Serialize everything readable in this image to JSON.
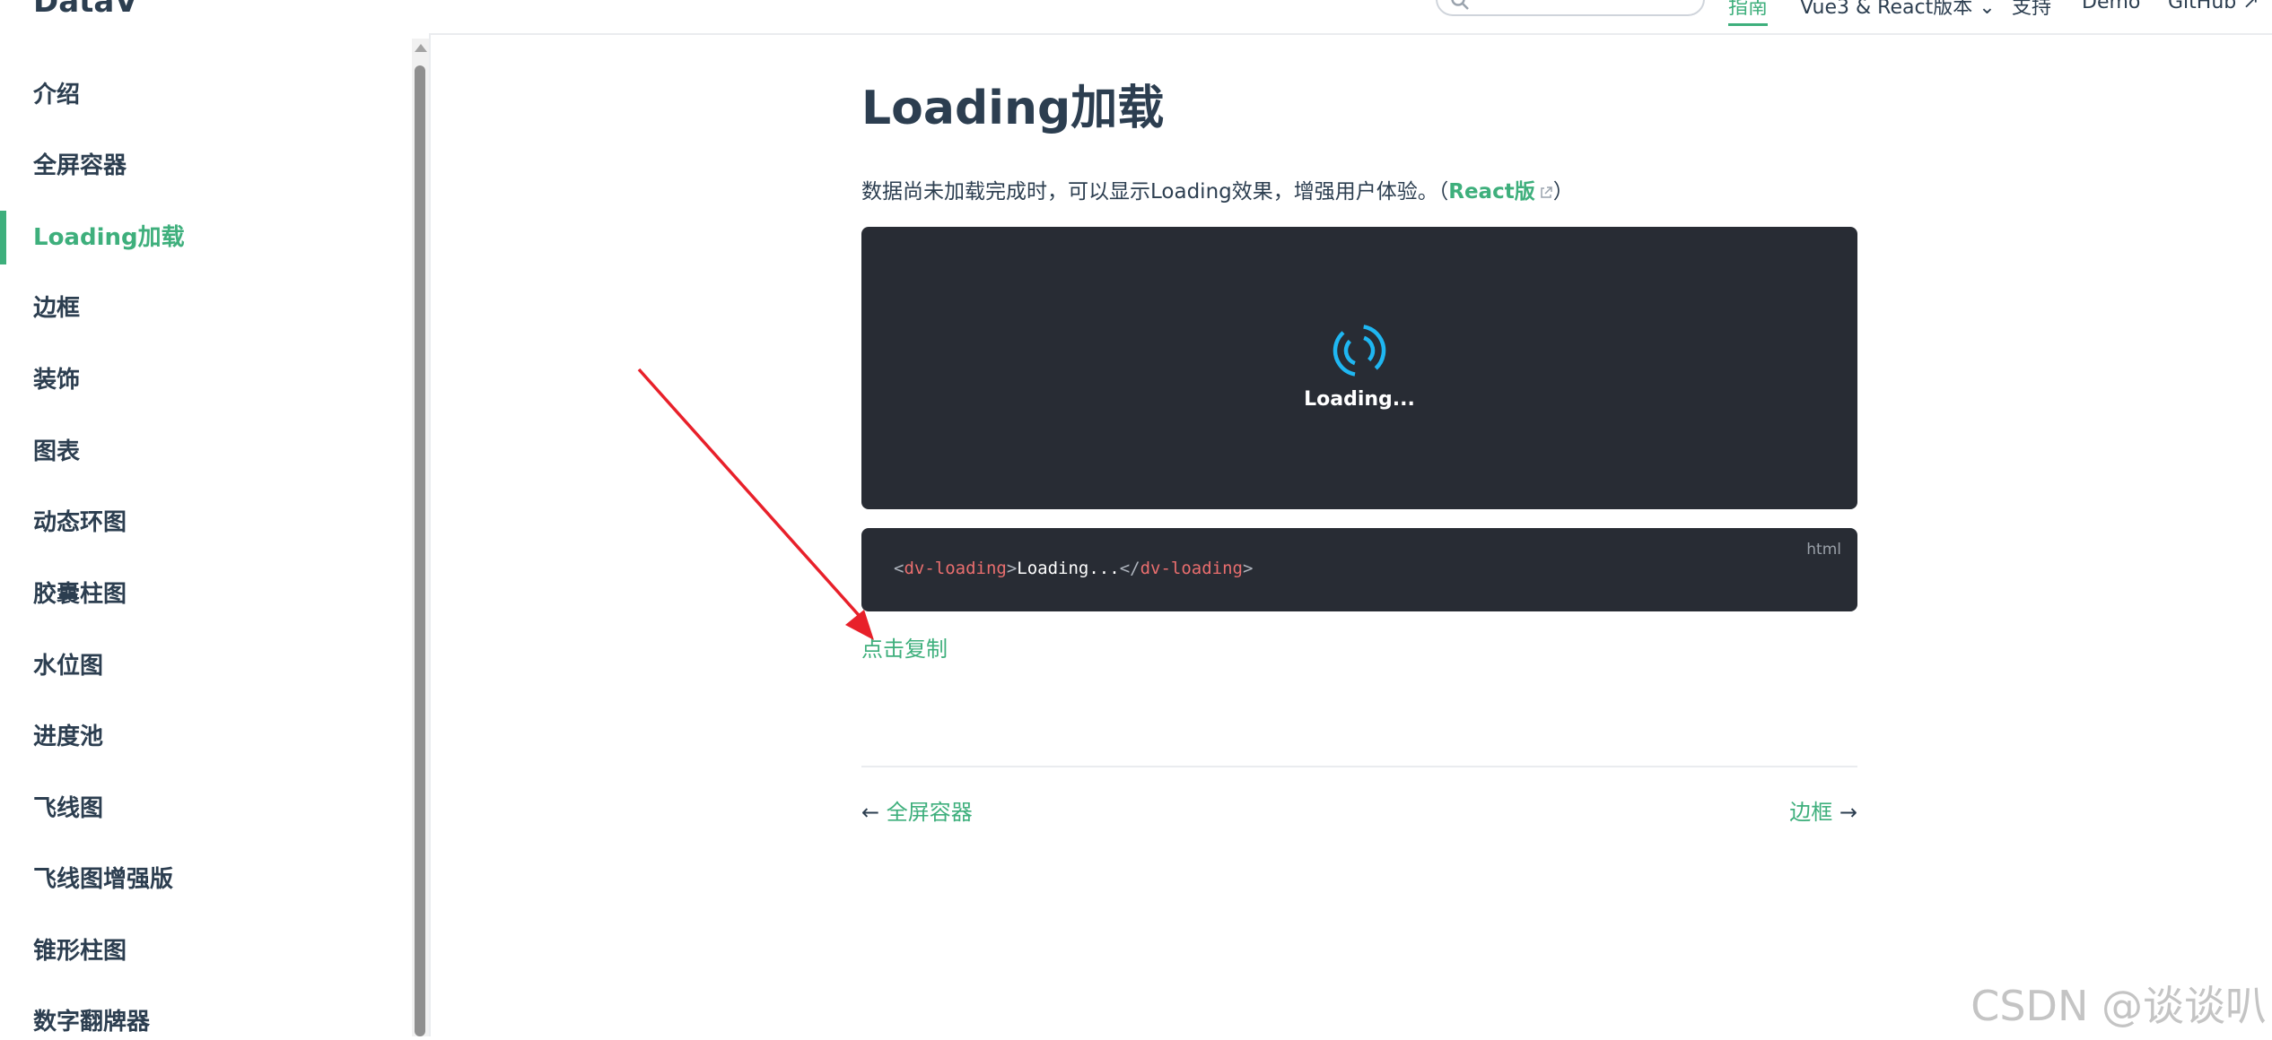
{
  "navbar": {
    "brand": "DataV",
    "search": {
      "value": "",
      "placeholder": ""
    },
    "links": [
      {
        "label": "指南",
        "active": true
      },
      {
        "label": "Vue3 & React版本 ⌄"
      },
      {
        "label": "支持"
      },
      {
        "label": "Demo"
      },
      {
        "label": "GitHub ↗"
      }
    ]
  },
  "sidebar": {
    "active_index": 2,
    "items": [
      {
        "label": "介绍"
      },
      {
        "label": "全屏容器"
      },
      {
        "label": "Loading加载"
      },
      {
        "label": "边框"
      },
      {
        "label": "装饰"
      },
      {
        "label": "图表"
      },
      {
        "label": "动态环图"
      },
      {
        "label": "胶囊柱图"
      },
      {
        "label": "水位图"
      },
      {
        "label": "进度池"
      },
      {
        "label": "飞线图"
      },
      {
        "label": "飞线图增强版"
      },
      {
        "label": "锥形柱图"
      },
      {
        "label": "数字翻牌器"
      }
    ]
  },
  "main": {
    "title": "Loading加载",
    "intro_text": "数据尚未加载完成时，可以显示Loading效果，增强用户体验。（",
    "intro_link": "React版",
    "intro_close": "）",
    "demo": {
      "loading_text": "Loading..."
    },
    "code": {
      "lang": "html",
      "open_lt": "<",
      "open_tag": "dv-loading",
      "open_gt": ">",
      "content": "Loading...",
      "close_lt": "</",
      "close_tag": "dv-loading",
      "close_gt": ">"
    },
    "copy_label": "点击复制",
    "prev": {
      "arrow": "←",
      "label": "全屏容器"
    },
    "next": {
      "label": "边框",
      "arrow": "→"
    }
  },
  "watermark": "CSDN @谈谈叭",
  "colors": {
    "accent": "#3eaf7c",
    "text": "#2c3e50",
    "code_bg": "#282c34",
    "loader": "#1fb7f2",
    "code_tag": "#e96e6e",
    "annotation_arrow": "#e8202a"
  }
}
